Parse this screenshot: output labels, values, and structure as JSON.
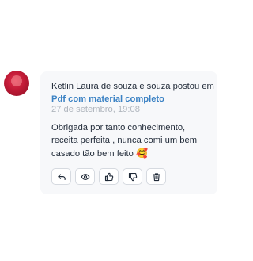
{
  "activity": {
    "author_line": "Ketlin Laura de souza e souza postou em",
    "link_text": "Pdf com material completo",
    "date": "27 de setembro, 19:08",
    "comment": "Obrigada por tanto conhecimento, receita perfeita , nunca comi um bem casado tão bem feito",
    "emoji": "🥰"
  },
  "actions": [
    {
      "icon": "reply-icon"
    },
    {
      "icon": "eye-icon"
    },
    {
      "icon": "thumbs-up-icon"
    },
    {
      "icon": "thumbs-down-icon"
    },
    {
      "icon": "trash-icon"
    }
  ]
}
